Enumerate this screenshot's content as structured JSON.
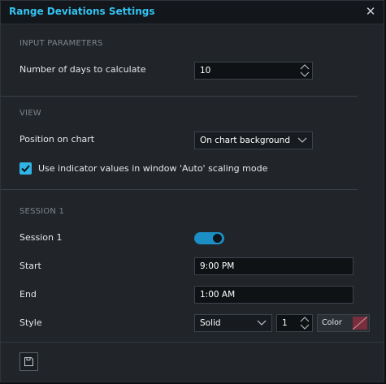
{
  "window": {
    "title": "Range Deviations Settings"
  },
  "sections": {
    "input_parameters": {
      "header": "INPUT PARAMETERS",
      "days_label": "Number of days to calculate",
      "days_value": "10"
    },
    "view": {
      "header": "VIEW",
      "position_label": "Position on chart",
      "position_value": "On chart background",
      "auto_scale_label": "Use indicator values in window 'Auto' scaling mode",
      "auto_scale_checked": true
    },
    "session1": {
      "header": "SESSION 1",
      "session_label": "Session 1",
      "session_enabled": true,
      "start_label": "Start",
      "start_value": "9:00 PM",
      "end_label": "End",
      "end_value": "1:00 AM",
      "style_label": "Style",
      "style_value": "Solid",
      "width_value": "1",
      "color_label": "Color",
      "color_value": "#7a2e3d"
    }
  },
  "colors": {
    "accent": "#33c3f2",
    "toggle_on": "#1b8fc5",
    "checkbox": "#2fb5e5"
  },
  "footer": {
    "save_icon": "save-template-icon"
  }
}
